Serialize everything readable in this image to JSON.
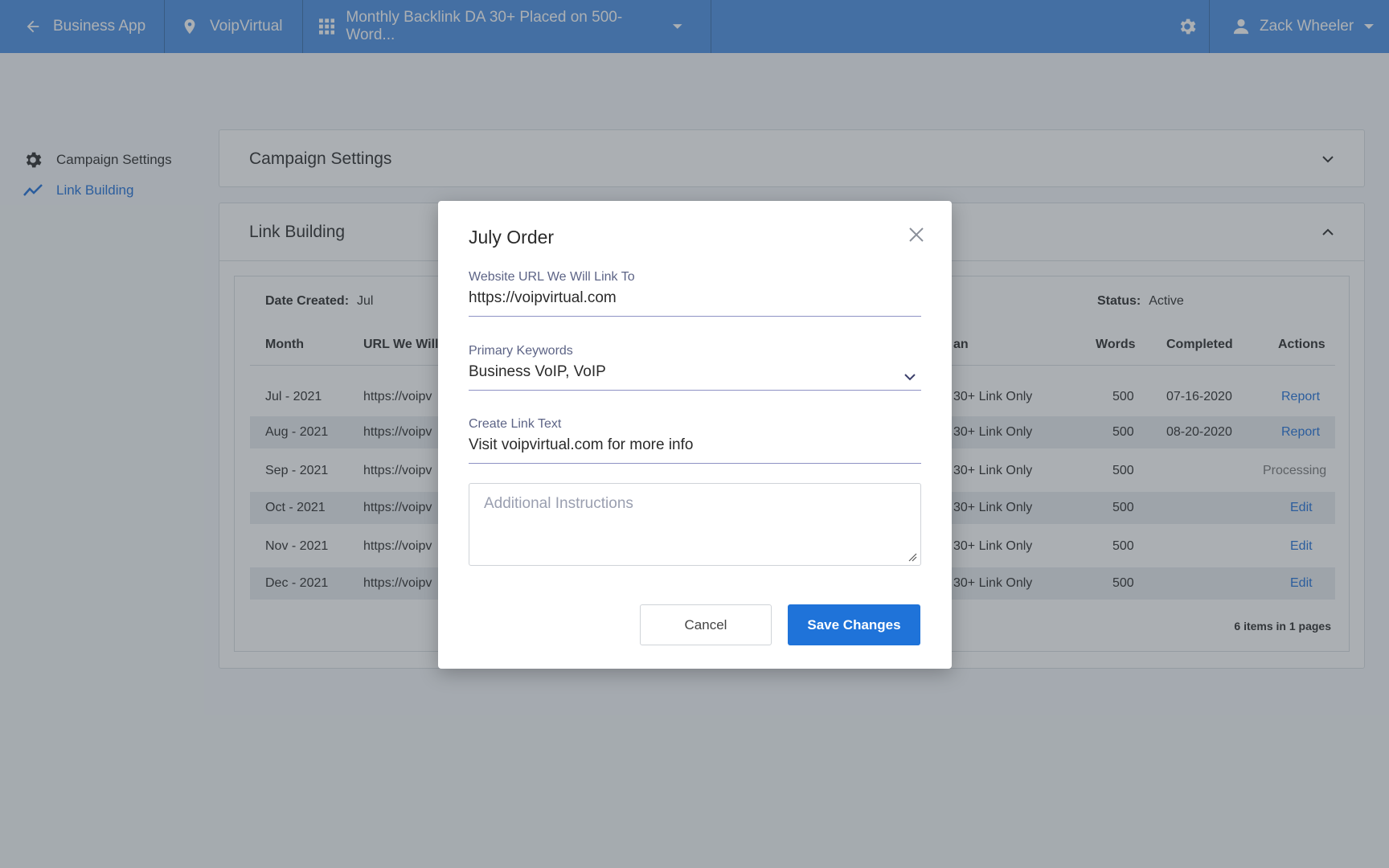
{
  "topbar": {
    "back_label": "Business App",
    "location_label": "VoipVirtual",
    "product_label": "Monthly Backlink DA 30+ Placed on 500-Word...",
    "user_name": "Zack Wheeler",
    "accent_color": "#4a8fe3"
  },
  "sidebar": {
    "items": [
      {
        "label": "Campaign Settings",
        "icon": "gear-icon"
      },
      {
        "label": "Link Building",
        "icon": "trend-icon"
      }
    ]
  },
  "panels": {
    "campaign_settings_title": "Campaign Settings",
    "link_building_title": "Link Building"
  },
  "table": {
    "date_created_label": "Date Created:",
    "date_created_value": "Jul",
    "status_label": "Status:",
    "status_value": "Active",
    "headers": {
      "month": "Month",
      "url": "URL We Will",
      "plan": "an",
      "words": "Words",
      "completed": "Completed",
      "actions": "Actions"
    },
    "rows": [
      {
        "month": "Jul - 2021",
        "url": "https://voipv",
        "plan": "30+ Link Only",
        "words": "500",
        "completed": "07-16-2020",
        "action": "Report"
      },
      {
        "month": "Aug - 2021",
        "url": "https://voipv",
        "plan": "30+ Link Only",
        "words": "500",
        "completed": "08-20-2020",
        "action": "Report"
      },
      {
        "month": "Sep - 2021",
        "url": "https://voipv",
        "plan": "30+ Link Only",
        "words": "500",
        "completed": "",
        "action": "Processing"
      },
      {
        "month": "Oct - 2021",
        "url": "https://voipv",
        "plan": "30+ Link Only",
        "words": "500",
        "completed": "",
        "action": "Edit"
      },
      {
        "month": "Nov - 2021",
        "url": "https://voipv",
        "plan": "30+ Link Only",
        "words": "500",
        "completed": "",
        "action": "Edit"
      },
      {
        "month": "Dec - 2021",
        "url": "https://voipv",
        "plan": "30+ Link Only",
        "words": "500",
        "completed": "",
        "action": "Edit"
      }
    ],
    "pager_text": "6 items in 1 pages"
  },
  "modal": {
    "title": "July Order",
    "website_url_label": "Website URL We Will Link To",
    "website_url_value": "https://voipvirtual.com",
    "keywords_label": "Primary Keywords",
    "keywords_value": "Business VoIP, VoIP",
    "link_text_label": "Create Link Text",
    "link_text_value": "Visit voipvirtual.com for more info",
    "instructions_placeholder": "Additional Instructions",
    "cancel_label": "Cancel",
    "save_label": "Save Changes",
    "primary_color": "#1f73d9"
  }
}
